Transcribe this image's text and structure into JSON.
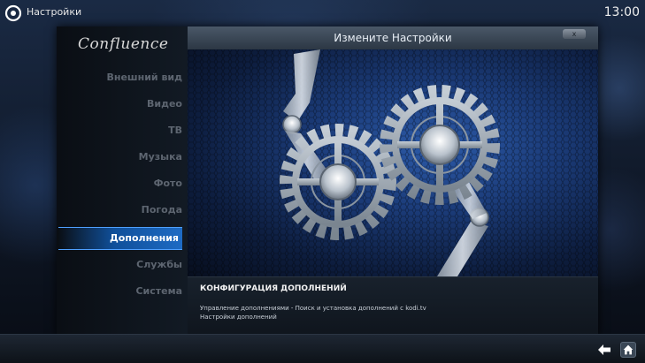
{
  "topbar": {
    "title": "Настройки",
    "clock": "13:00"
  },
  "sidebar": {
    "logo": "Confluence",
    "items": [
      {
        "label": "Внешний вид"
      },
      {
        "label": "Видео"
      },
      {
        "label": "ТВ"
      },
      {
        "label": "Музыка"
      },
      {
        "label": "Фото"
      },
      {
        "label": "Погода"
      },
      {
        "label": "Дополнения",
        "selected": true
      },
      {
        "label": "Службы"
      },
      {
        "label": "Система"
      }
    ]
  },
  "content": {
    "header_title": "Измените Настройки",
    "close_label": "x",
    "info_title": "КОНФИГУРАЦИЯ ДОПОЛНЕНИЙ",
    "info_line1": "Управление дополнениями - Поиск и установка дополнений с kodi.tv",
    "info_line2": "Настройки дополнений"
  },
  "icons": {
    "top_left": "power-icon",
    "artwork": "gears-icon",
    "bottom_back": "back-arrow-icon",
    "bottom_home": "home-icon"
  },
  "colors": {
    "accent": "#1e6bc4",
    "background": "#0c1119"
  }
}
